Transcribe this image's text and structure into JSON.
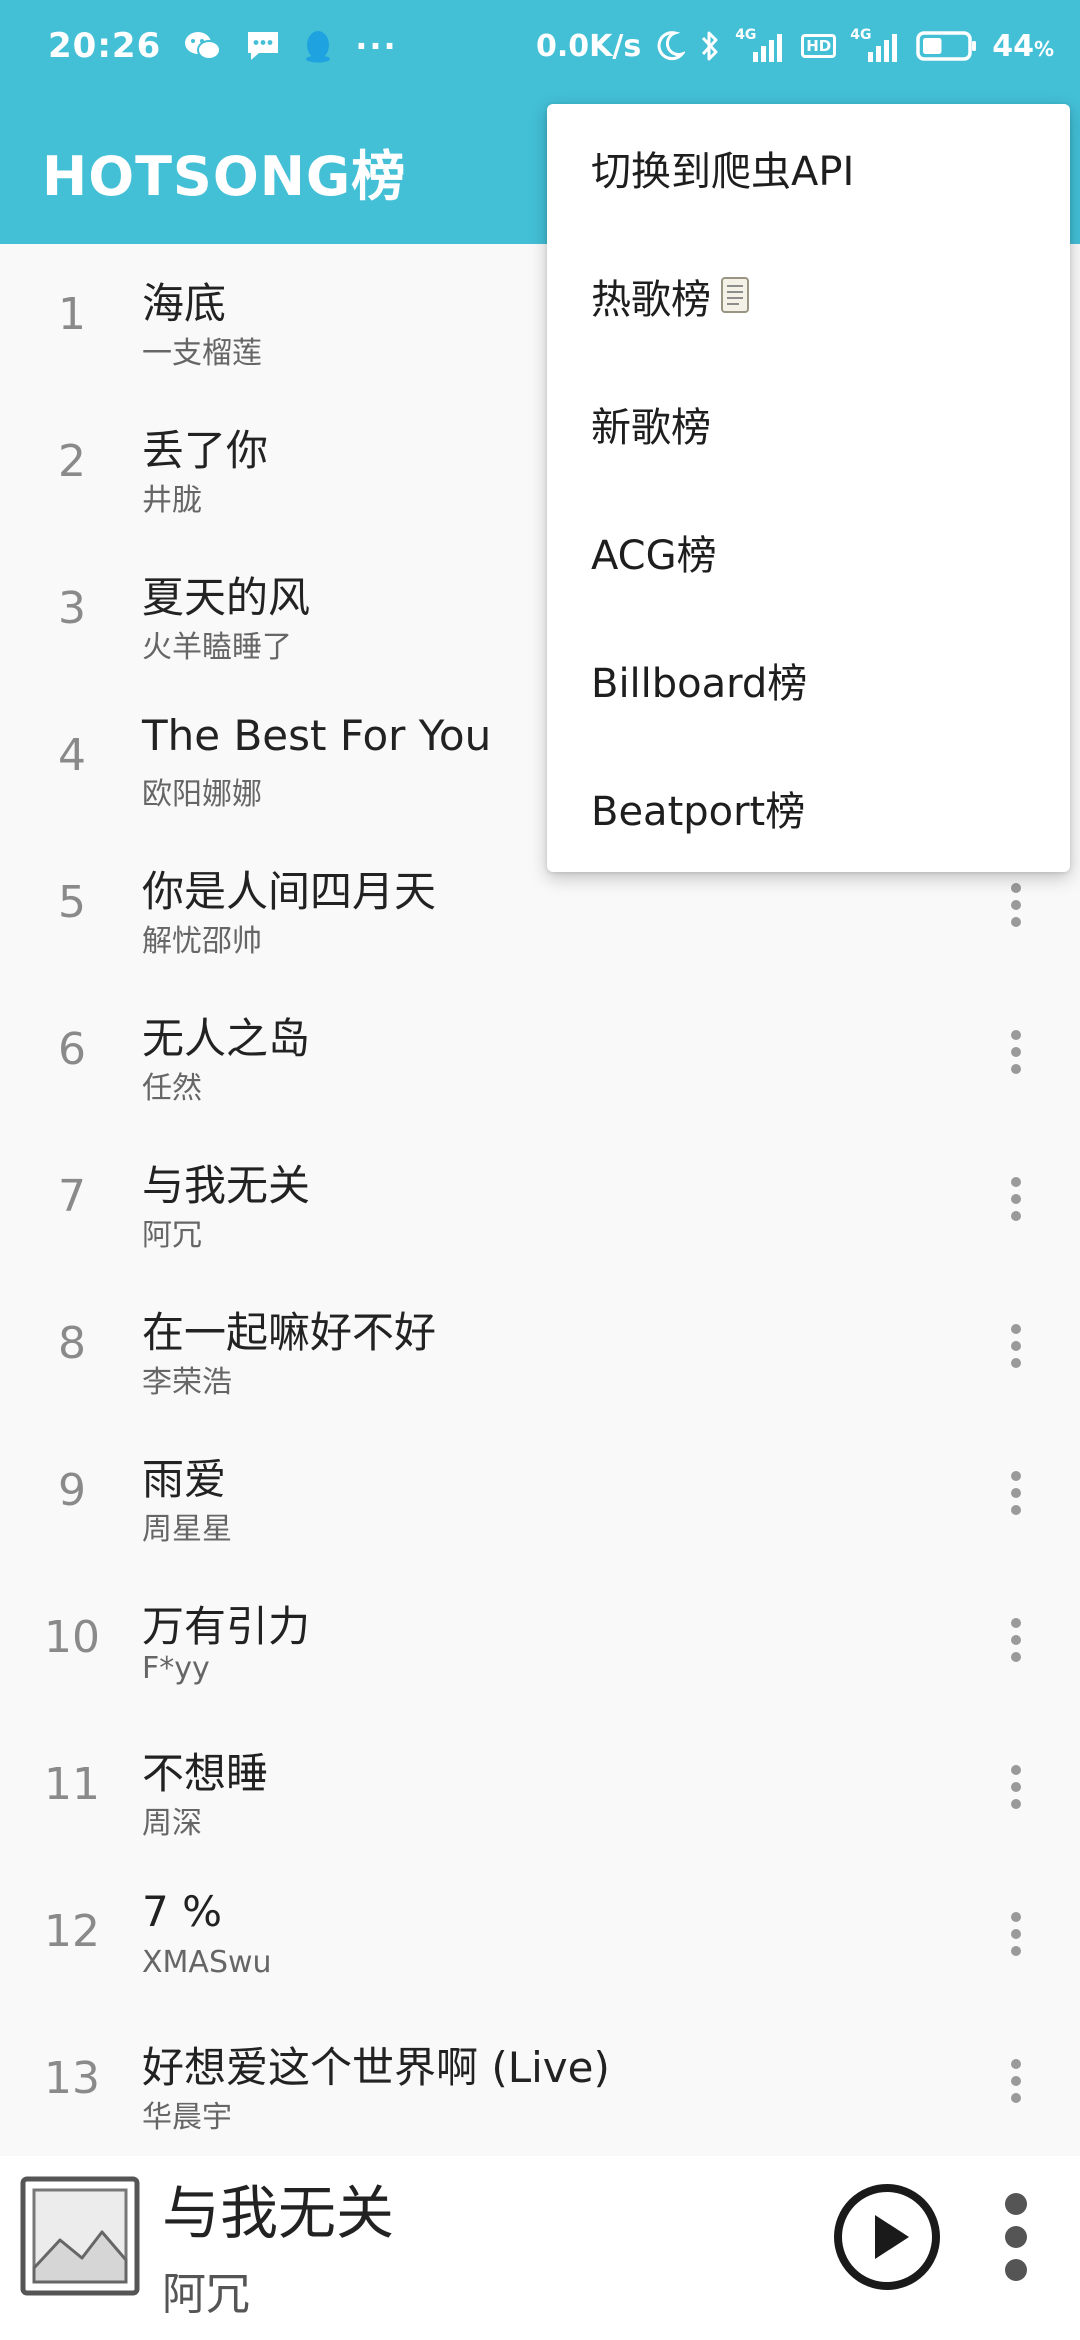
{
  "status_bar": {
    "time": "20:26",
    "more": "···",
    "network_speed": "0.0K/s",
    "tag_4g_1": "4G",
    "tag_hd": "HD",
    "tag_4g_2": "4G",
    "battery": "44",
    "battery_unit": "%",
    "battery_level": 0.44
  },
  "header": {
    "title": "HOTSONG榜"
  },
  "songs": [
    {
      "rank": "1",
      "title": "海底",
      "artist": "一支榴莲"
    },
    {
      "rank": "2",
      "title": "丢了你",
      "artist": "井胧"
    },
    {
      "rank": "3",
      "title": "夏天的风",
      "artist": "火羊瞌睡了"
    },
    {
      "rank": "4",
      "title": "The Best For You",
      "artist": "欧阳娜娜"
    },
    {
      "rank": "5",
      "title": "你是人间四月天",
      "artist": "解忧邵帅"
    },
    {
      "rank": "6",
      "title": "无人之岛",
      "artist": "任然"
    },
    {
      "rank": "7",
      "title": "与我无关",
      "artist": "阿冗"
    },
    {
      "rank": "8",
      "title": "在一起嘛好不好",
      "artist": "李荣浩"
    },
    {
      "rank": "9",
      "title": "雨爱",
      "artist": "周星星"
    },
    {
      "rank": "10",
      "title": "万有引力",
      "artist": "F*yy"
    },
    {
      "rank": "11",
      "title": "不想睡",
      "artist": "周深"
    },
    {
      "rank": "12",
      "title": "7 %",
      "artist": "XMASwu"
    },
    {
      "rank": "13",
      "title": "好想爱这个世界啊 (Live)",
      "artist": "华晨宇"
    }
  ],
  "player": {
    "title": "与我无关",
    "artist": "阿冗"
  },
  "menu": {
    "items": [
      {
        "label": "切换到爬虫API"
      },
      {
        "label": "热歌榜",
        "icon": "scroll-icon"
      },
      {
        "label": "新歌榜"
      },
      {
        "label": "ACG榜"
      },
      {
        "label": "Billboard榜"
      },
      {
        "label": "Beatport榜"
      }
    ]
  },
  "colors": {
    "header": "#43bfd6",
    "background": "#f9f9f9",
    "menu": "#ffffff"
  }
}
